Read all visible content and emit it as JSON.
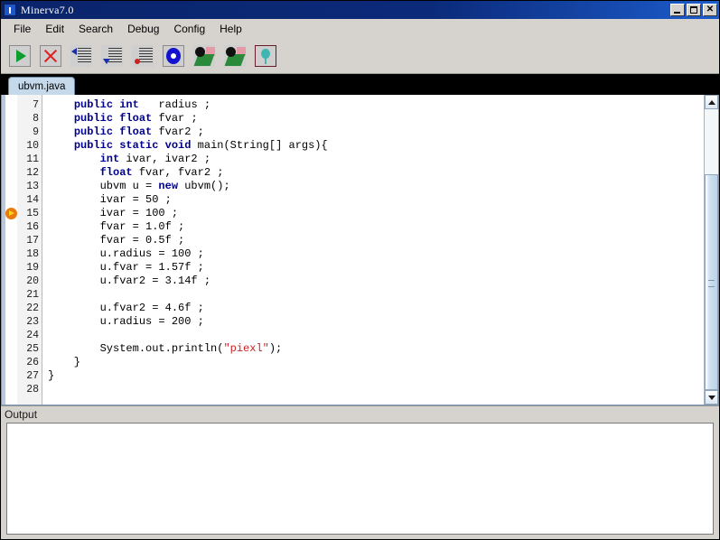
{
  "window": {
    "title": "Minerva7.0",
    "icon": "app-icon",
    "buttons": {
      "minimize": "minimize",
      "maximize": "maximize",
      "close": "✕"
    }
  },
  "menubar": {
    "items": [
      {
        "label": "File"
      },
      {
        "label": "Edit"
      },
      {
        "label": "Search"
      },
      {
        "label": "Debug"
      },
      {
        "label": "Config"
      },
      {
        "label": "Help"
      }
    ]
  },
  "toolbar": {
    "buttons": [
      {
        "icon": "run-icon",
        "name": "run-button"
      },
      {
        "icon": "stop-icon",
        "name": "stop-button"
      },
      {
        "icon": "step-over-icon",
        "name": "step-over-button"
      },
      {
        "icon": "step-into-icon",
        "name": "step-into-button"
      },
      {
        "icon": "step-out-icon",
        "name": "step-out-button"
      },
      {
        "icon": "breakpoint-icon",
        "name": "breakpoint-button"
      },
      {
        "icon": "watch-icon",
        "name": "watch-button"
      },
      {
        "icon": "inspect-icon",
        "name": "inspect-button"
      },
      {
        "icon": "memory-icon",
        "name": "memory-button"
      }
    ]
  },
  "tabs": [
    {
      "label": "ubvm.java",
      "active": true
    }
  ],
  "editor": {
    "first_line_number": 7,
    "breakpoint_line": 15,
    "lines": [
      {
        "n": 7,
        "text": "    public int   radius ;"
      },
      {
        "n": 8,
        "text": "    public float fvar ;"
      },
      {
        "n": 9,
        "text": "    public float fvar2 ;"
      },
      {
        "n": 10,
        "text": "    public static void main(String[] args){"
      },
      {
        "n": 11,
        "text": "        int ivar, ivar2 ;"
      },
      {
        "n": 12,
        "text": "        float fvar, fvar2 ;"
      },
      {
        "n": 13,
        "text": "        ubvm u = new ubvm();"
      },
      {
        "n": 14,
        "text": "        ivar = 50 ;"
      },
      {
        "n": 15,
        "text": "        ivar = 100 ;"
      },
      {
        "n": 16,
        "text": "        fvar = 1.0f ;"
      },
      {
        "n": 17,
        "text": "        fvar = 0.5f ;"
      },
      {
        "n": 18,
        "text": "        u.radius = 100 ;"
      },
      {
        "n": 19,
        "text": "        u.fvar = 1.57f ;"
      },
      {
        "n": 20,
        "text": "        u.fvar2 = 3.14f ;"
      },
      {
        "n": 21,
        "text": ""
      },
      {
        "n": 22,
        "text": "        u.fvar2 = 4.6f ;"
      },
      {
        "n": 23,
        "text": "        u.radius = 200 ;"
      },
      {
        "n": 24,
        "text": ""
      },
      {
        "n": 25,
        "text": "        System.out.println(\"piexl\");"
      },
      {
        "n": 26,
        "text": "    }"
      },
      {
        "n": 27,
        "text": "}"
      },
      {
        "n": 28,
        "text": ""
      }
    ]
  },
  "output": {
    "label": "Output",
    "text": ""
  },
  "colors": {
    "titlebar": "#0a246a",
    "chrome": "#d6d3ce",
    "tab_active": "#c6d9ea",
    "tabstrip": "#000000",
    "keyword": "#00008f",
    "string": "#cc2222",
    "breakpoint": "#e87a10"
  }
}
